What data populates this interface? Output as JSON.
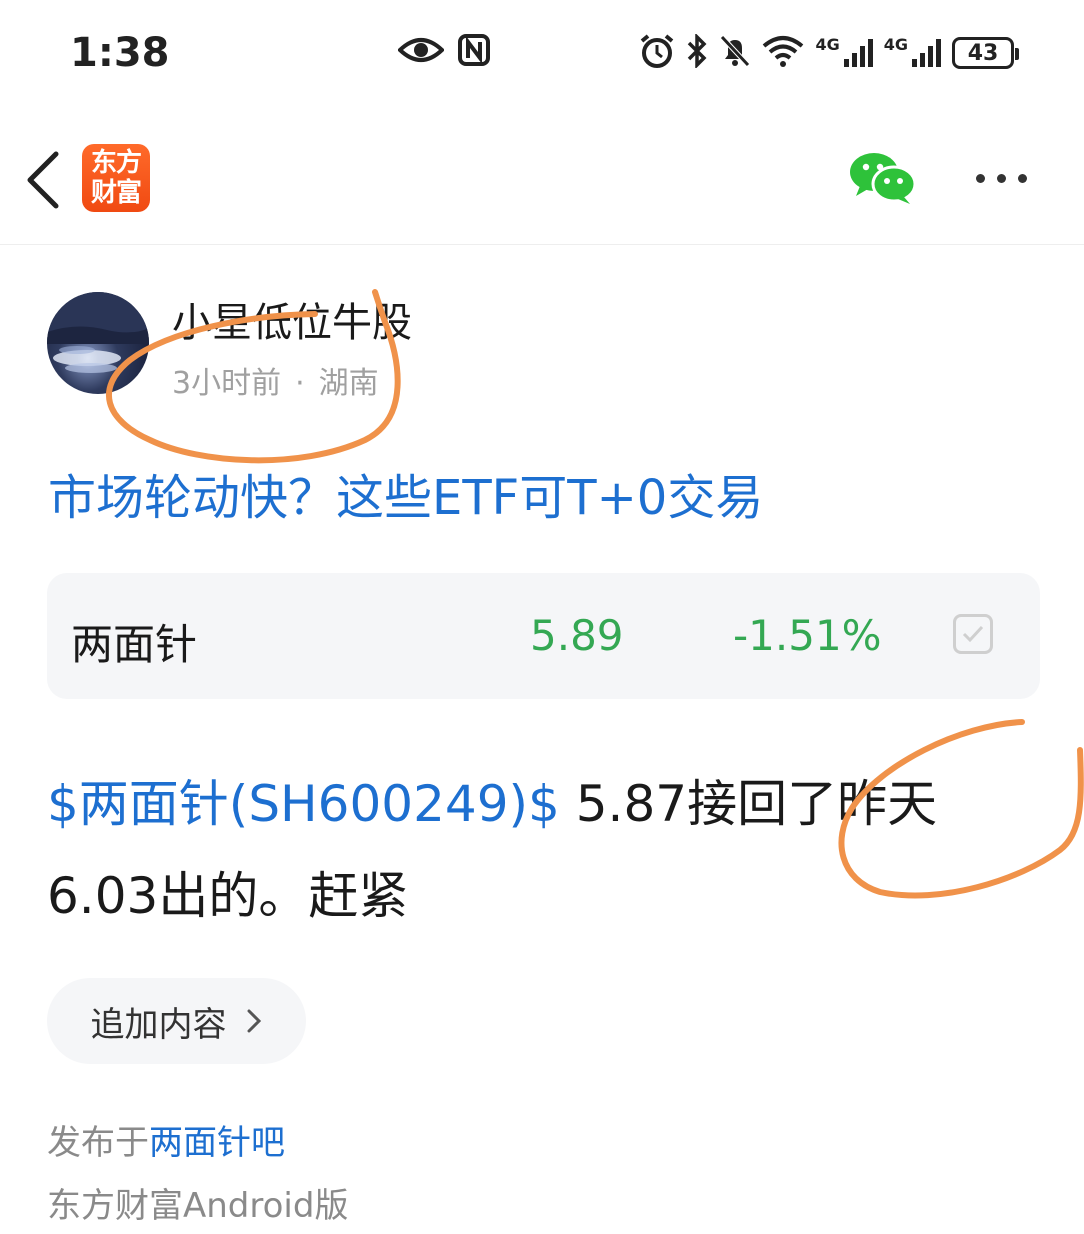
{
  "status_bar": {
    "time": "1:38",
    "net1": "4G",
    "net2": "4G",
    "battery": "43",
    "icons": [
      "eye-icon",
      "nfc-icon",
      "alarm-icon",
      "bluetooth-icon",
      "bell-muted-icon",
      "wifi-icon",
      "signal-icon",
      "signal-icon",
      "battery-icon"
    ]
  },
  "nav": {
    "logo_line1": "东方",
    "logo_line2": "财富",
    "logo_color": "#f0541b",
    "wechat_color": "#2ec23a"
  },
  "post": {
    "author": "小星低位牛股",
    "time_ago": "3小时前",
    "separator": "·",
    "location": "湖南",
    "title": "市场轮动快？这些ETF可T+0交易",
    "stock_card": {
      "name": "两面针",
      "price": "5.89",
      "change": "-1.51%"
    },
    "body": {
      "stock_tag": "$两面针(SH600249)$",
      "text": " 5.87接回了昨天6.03出的。赶紧"
    },
    "append_label": "追加内容",
    "published_prefix": "发布于",
    "published_bar": "两面针吧",
    "platform": "东方财富Android版"
  },
  "colors": {
    "link_blue": "#1d6fd0",
    "stock_green": "#34a853",
    "annotation_orange": "#f0924a"
  }
}
